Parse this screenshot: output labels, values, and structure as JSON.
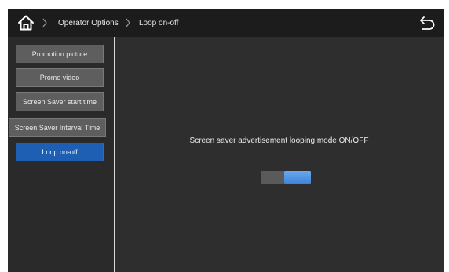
{
  "header": {
    "breadcrumb": [
      "Operator Options",
      "Loop on-off"
    ],
    "home_icon": "home-icon",
    "back_icon": "back-arrow-icon"
  },
  "sidebar": {
    "items": [
      {
        "label": "Promotion picture",
        "active": false
      },
      {
        "label": "Promo video",
        "active": false
      },
      {
        "label": "Screen Saver start time",
        "active": false
      },
      {
        "label": "Screen Saver Interval Time",
        "active": false
      },
      {
        "label": "Loop on-off",
        "active": true
      }
    ]
  },
  "main": {
    "description": "Screen saver advertisement looping mode ON/OFF",
    "toggle_state": "on"
  },
  "colors": {
    "accent": "#1f5fb3",
    "toggle_on": "#3b82d8",
    "background": "#2e2e2e",
    "topbar": "#1c1c1c"
  }
}
